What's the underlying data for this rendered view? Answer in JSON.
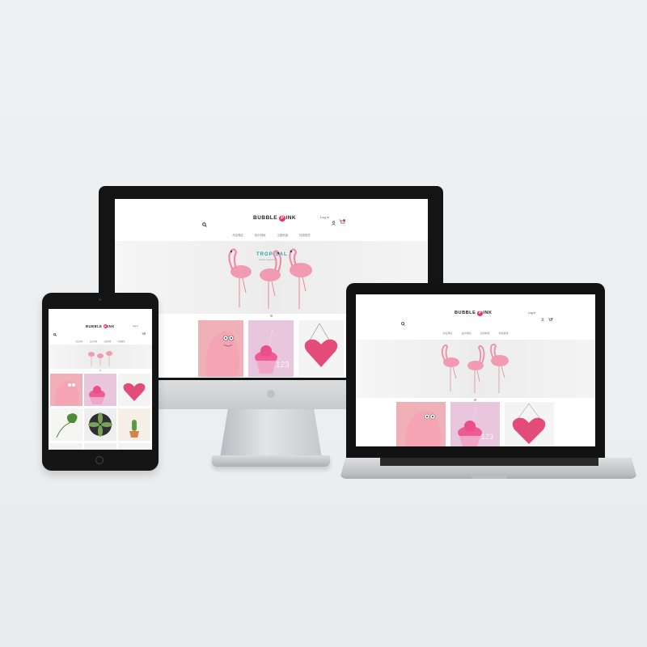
{
  "brand": {
    "logo_text_left": "BUBBLE ",
    "logo_p": "P",
    "logo_text_right": "INK",
    "accent": "#e8336a"
  },
  "header": {
    "login_label": "Log in",
    "search_icon": "search-icon",
    "user_icon": "user-icon",
    "cart_icon": "cart-icon"
  },
  "nav": {
    "items": [
      "商品專區",
      "設計師館",
      "主題精選",
      "特價優惠"
    ]
  },
  "hero": {
    "title": "TROPICAL",
    "subtitle": "Summer Collection"
  },
  "products": {
    "row1": [
      "barbapapa-card",
      "cupcake-card",
      "heart-bag-card"
    ],
    "row2": [
      "monstera-leaf-card",
      "succulent-card",
      "cactus-card"
    ],
    "numbers_text": "123"
  },
  "colors": {
    "pink_main": "#e8336a",
    "pink_soft": "#f3b6c4",
    "bezel": "#161616"
  }
}
